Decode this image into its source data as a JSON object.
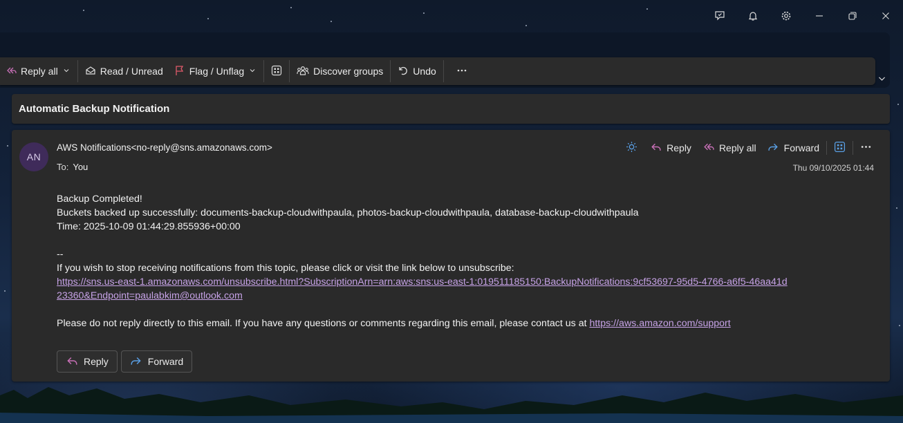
{
  "toolbar": {
    "reply_all": "Reply all",
    "read_unread": "Read / Unread",
    "flag_unflag": "Flag / Unflag",
    "discover_groups": "Discover groups",
    "undo": "Undo"
  },
  "subject": "Automatic Backup Notification",
  "message": {
    "avatar_initials": "AN",
    "from": "AWS Notifications<no-reply@sns.amazonaws.com>",
    "to_label": "To:",
    "to_value": "You",
    "date": "Thu 09/10/2025 01:44",
    "actions": {
      "reply": "Reply",
      "reply_all": "Reply all",
      "forward": "Forward"
    },
    "body": {
      "line1": "Backup Completed!",
      "line2": "Buckets backed up successfully: documents-backup-cloudwithpaula, photos-backup-cloudwithpaula, database-backup-cloudwithpaula",
      "line3": "Time: 2025-10-09 01:44:29.855936+00:00",
      "separator": "--",
      "unsubscribe_text": "If you wish to stop receiving notifications from this topic, please click or visit the link below to unsubscribe:",
      "unsubscribe_link": "https://sns.us-east-1.amazonaws.com/unsubscribe.html?SubscriptionArn=arn:aws:sns:us-east-1:019511185150:BackupNotifications:9cf53697-95d5-4766-a6f5-46aa41d23360&Endpoint=paulabkim@outlook.com",
      "contact_text": "Please do not reply directly to this email. If you have any questions or comments regarding this email, please contact us at ",
      "support_link": "https://aws.amazon.com/support"
    },
    "bottom_buttons": {
      "reply": "Reply",
      "forward": "Forward"
    }
  },
  "colors": {
    "reply_accent": "#c970b8",
    "forward_accent": "#5aa0e6",
    "link": "#c6a2e6",
    "flag": "#e05a6a"
  },
  "icons": [
    "chat-check-icon",
    "bell-icon",
    "gear-icon",
    "minimize-icon",
    "restore-icon",
    "close-icon",
    "reply-all-icon",
    "envelope-open-icon",
    "flag-icon",
    "apps-icon",
    "people-icon",
    "undo-icon",
    "more-icon",
    "sun-icon",
    "reply-icon",
    "forward-icon",
    "chevron-down-icon"
  ]
}
